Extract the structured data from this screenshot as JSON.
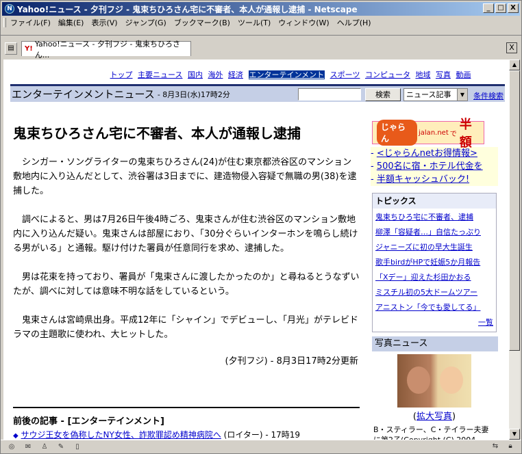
{
  "window": {
    "title": "Yahoo!ニュース - 夕刊フジ - 鬼束ちひろさん宅に不審者、本人が通報し逮捕 - Netscape",
    "min_glyph": "_",
    "max_glyph": "□",
    "close_glyph": "X"
  },
  "menu": [
    "ファイル(F)",
    "編集(E)",
    "表示(V)",
    "ジャンプ(G)",
    "ブックマーク(B)",
    "ツール(T)",
    "ウィンドウ(W)",
    "ヘルプ(H)"
  ],
  "tab": {
    "label": "Yahoo!ニュース - 夕刊フジ - 鬼束ちひろさん...",
    "logo": "Y!",
    "close_glyph": "X"
  },
  "nav": {
    "links": [
      "トップ",
      "主要ニュース",
      "国内",
      "海外",
      "経済",
      "エンターテインメント",
      "スポーツ",
      "コンピュータ",
      "地域",
      "写真",
      "動画"
    ],
    "active_index": 5
  },
  "section": {
    "title": "エンターテインメントニュース",
    "date": "- 8月3日(水)17時2分",
    "search_value": "",
    "search_button": "検索",
    "select_value": "ニュース記事",
    "advanced_link": "条件検索"
  },
  "article": {
    "headline": "鬼束ちひろさん宅に不審者、本人が通報し逮捕",
    "paragraphs": [
      "シンガー・ソングライターの鬼束ちひろさん(24)が住む東京都渋谷区のマンション敷地内に入り込んだとして、渋谷署は3日までに、建造物侵入容疑で無職の男(38)を逮捕した。",
      "調べによると、男は7月26日午後4時ごろ、鬼束さんが住む渋谷区のマンション敷地内に入り込んだ疑い。鬼束さんは部屋におり、「30分ぐらいインターホンを鳴らし続ける男がいる」と通報。駆け付けた署員が任意同行を求め、逮捕した。",
      "男は花束を持っており、署員が「鬼束さんに渡したかったのか」と尋ねるとうなずいたが、調べに対しては意味不明な話をしているという。",
      "鬼束さんは宮崎県出身。平成12年に「シャイン」でデビューし、「月光」がテレビドラマの主題歌に使われ、大ヒットした。"
    ],
    "byline": "(夕刊フジ) - 8月3日17時2分更新"
  },
  "related": {
    "heading": "前後の記事 - [エンターテインメント]",
    "item_link": "サウジ王女を偽称したNY女性、詐欺罪認め精神病院へ",
    "item_source": "(ロイター) - 17時19"
  },
  "sidebar": {
    "ad_banner": {
      "logo": "じゃらん",
      "domain": "jalan.net",
      "connector": "で",
      "headline": "半額"
    },
    "ad_links": [
      "<じゃらんnetお得情報>",
      "500名に宿・ホテル代金を",
      "半額キャッシュバック!"
    ],
    "topics": {
      "heading": "トピックス",
      "items": [
        "鬼束ちひろ宅に不審者、逮捕",
        "柳澤「容疑者…」自信たっぷり",
        "ジャニーズに初の早大生誕生",
        "歌手birdがHPで妊娠5か月報告",
        "「Xデー」迎えた杉田かおる",
        "ミスチル初の5大ドームツアー",
        "アニストン「今でも愛してる」"
      ],
      "more": "一覧"
    },
    "photo": {
      "heading": "写真ニュース",
      "enlarge_link": "拡大写真",
      "caption": "B・スティラー、C・テイラー夫妻に第2子(Copyright (C) 2004"
    }
  }
}
